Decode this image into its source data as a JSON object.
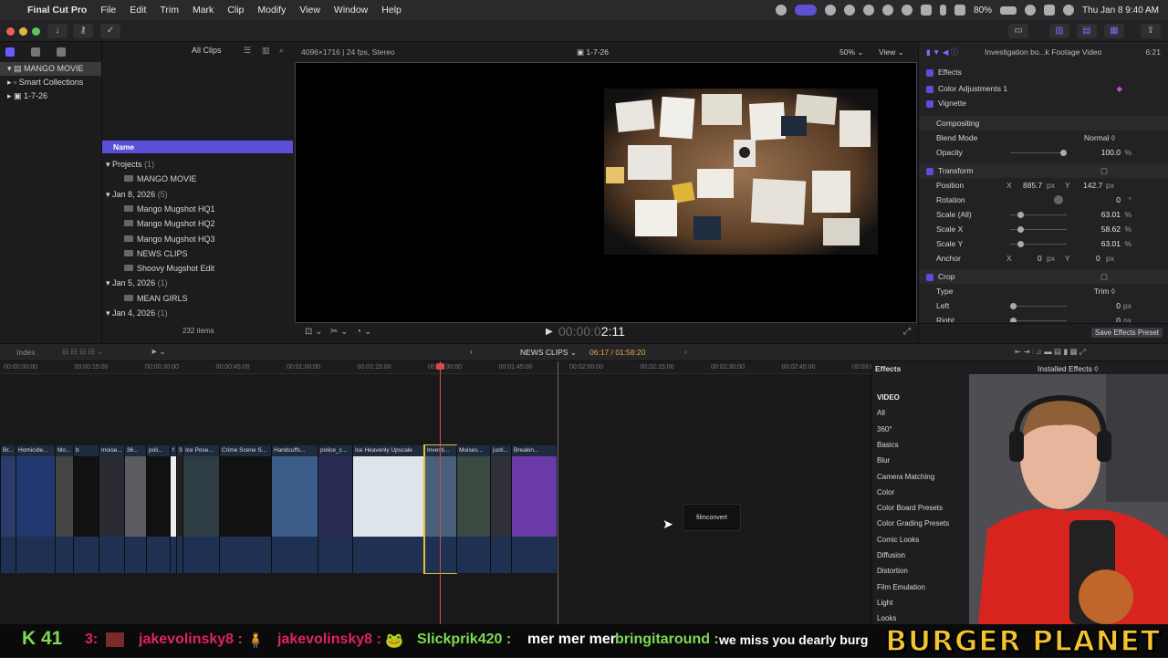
{
  "menubar": {
    "app": "Final Cut Pro",
    "items": [
      "File",
      "Edit",
      "Trim",
      "Mark",
      "Clip",
      "Modify",
      "View",
      "Window",
      "Help"
    ],
    "battery": "80%",
    "clock": "Thu Jan 8  9:40 AM"
  },
  "library": {
    "items": [
      "MANGO MOVIE",
      "Smart Collections",
      "1-7-26"
    ]
  },
  "browser": {
    "filter": "All Clips",
    "column_name": "Name",
    "rows": [
      {
        "kind": "group",
        "label": "Projects",
        "count": "(1)"
      },
      {
        "kind": "item",
        "label": "MANGO MOVIE"
      },
      {
        "kind": "group",
        "label": "Jan 8, 2026",
        "count": "(5)"
      },
      {
        "kind": "item",
        "label": "Mango Mugshot HQ1"
      },
      {
        "kind": "item",
        "label": "Mango Mugshot HQ2"
      },
      {
        "kind": "item",
        "label": "Mango Mugshot HQ3"
      },
      {
        "kind": "item",
        "label": "NEWS CLIPS"
      },
      {
        "kind": "item",
        "label": "Shoovy Mugshot Edit"
      },
      {
        "kind": "group",
        "label": "Jan 5, 2026",
        "count": "(1)"
      },
      {
        "kind": "item",
        "label": "MEAN GIRLS"
      },
      {
        "kind": "group",
        "label": "Jan 4, 2026",
        "count": "(1)"
      }
    ],
    "item_count": "232 items"
  },
  "viewer": {
    "format": "4096×1716 | 24 fps, Stereo",
    "title": "1-7-26",
    "zoom": "50%",
    "view": "View",
    "timecode": "00:00:02:11",
    "timecode_dim": "00:00:0",
    "timecode_bright": "2:11"
  },
  "inspector": {
    "clip_name": "Investigation bo...k Footage Video",
    "duration": "6:21",
    "effects_title": "Effects",
    "effects": [
      "Color Adjustments 1",
      "Vignette"
    ],
    "compositing": "Compositing",
    "blend_label": "Blend Mode",
    "blend_value": "Normal ◊",
    "opacity_label": "Opacity",
    "opacity_value": "100.0",
    "transform": "Transform",
    "position_label": "Position",
    "pos_x_label": "X",
    "pos_x": "885.7",
    "pos_y_label": "Y",
    "pos_y": "142.7",
    "rotation_label": "Rotation",
    "rotation": "0",
    "scale_all_label": "Scale (All)",
    "scale_all": "63.01",
    "scale_x_label": "Scale X",
    "scale_x": "58.62",
    "scale_y_label": "Scale Y",
    "scale_y": "63.01",
    "anchor_label": "Anchor",
    "anchor_x": "0",
    "anchor_y": "0",
    "crop": "Crop",
    "type_label": "Type",
    "type_value": "Trim ◊",
    "left_label": "Left",
    "left_value": "0",
    "right_label": "Right",
    "right_value": "0",
    "save_preset": "Save Effects Preset",
    "px": "px",
    "pct": "%",
    "deg": "°"
  },
  "timeline": {
    "index": "Index",
    "project": "NEWS CLIPS",
    "position": "06:17 / 01:58:20",
    "ruler": [
      "00:00:00:00",
      "00:00:15:00",
      "00:00:30:00",
      "00:00:45:00",
      "00:01:00:00",
      "00:01:15:00",
      "00:01:30:00",
      "00:01:45:00",
      "00:02:00:00",
      "00:02:15:00",
      "00:02:30:00",
      "00:02:45:00",
      "00:03:00:00"
    ],
    "clips": [
      "Br...",
      "Homicide...",
      "Mo...",
      "b",
      "moise...",
      "36...",
      "poli...",
      "f",
      "S",
      "Ice Pose...",
      "Crime Scene S...",
      "Handcuffs...",
      "police_c...",
      "Ice Heavenly Upscale",
      "Investi...",
      "Moises...",
      "justi...",
      "Breakin..."
    ],
    "drag_label": "filmconvert"
  },
  "effects_browser": {
    "title": "Effects",
    "installed": "Installed Effects ◊",
    "categories": [
      "VIDEO",
      "All",
      "360°",
      "Basics",
      "Blur",
      "Camera Matching",
      "Color",
      "Color Board Presets",
      "Color Grading Presets",
      "Comic Looks",
      "Diffusion",
      "Distortion",
      "Film Emulation",
      "Light",
      "Looks"
    ]
  },
  "stream": {
    "k_label": "K 41",
    "chat": [
      {
        "user": "3:",
        "msg": ""
      },
      {
        "user": "jakevolinsky8 :",
        "msg": "🧍"
      },
      {
        "user": "jakevolinsky8 :",
        "msg": "🐸"
      },
      {
        "user": "Slickprik420 :",
        "msg": "mer mer mer"
      },
      {
        "user": "bringitaround :",
        "msg": "we miss you dearly burg"
      }
    ],
    "brand": "BURGER PLANET"
  },
  "colors": {
    "accent": "#5b4fd6",
    "selected_clip": "#e6c229",
    "chat_user": "#e0245e",
    "chat_user2": "#7ed957",
    "brand": "#f4c430"
  }
}
